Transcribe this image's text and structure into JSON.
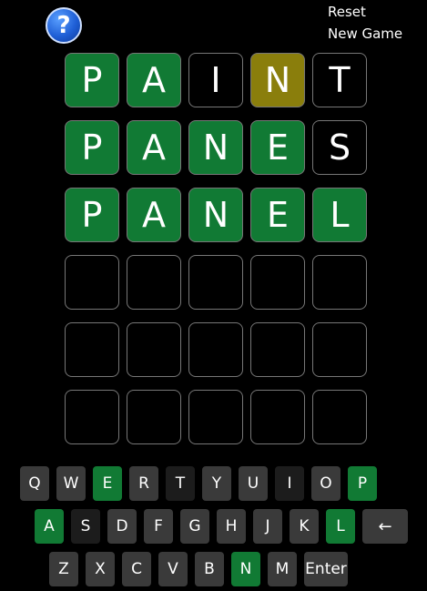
{
  "help": {
    "glyph": "?"
  },
  "menu": {
    "reset": "Reset",
    "new_game": "New Game"
  },
  "grid": {
    "rows": [
      [
        {
          "letter": "P",
          "state": "green"
        },
        {
          "letter": "A",
          "state": "green"
        },
        {
          "letter": "I",
          "state": "dark"
        },
        {
          "letter": "N",
          "state": "yellow"
        },
        {
          "letter": "T",
          "state": "dark"
        }
      ],
      [
        {
          "letter": "P",
          "state": "green"
        },
        {
          "letter": "A",
          "state": "green"
        },
        {
          "letter": "N",
          "state": "green"
        },
        {
          "letter": "E",
          "state": "green"
        },
        {
          "letter": "S",
          "state": "dark"
        }
      ],
      [
        {
          "letter": "P",
          "state": "green"
        },
        {
          "letter": "A",
          "state": "green"
        },
        {
          "letter": "N",
          "state": "green"
        },
        {
          "letter": "E",
          "state": "green"
        },
        {
          "letter": "L",
          "state": "green"
        }
      ],
      [
        {
          "letter": "",
          "state": "empty"
        },
        {
          "letter": "",
          "state": "empty"
        },
        {
          "letter": "",
          "state": "empty"
        },
        {
          "letter": "",
          "state": "empty"
        },
        {
          "letter": "",
          "state": "empty"
        }
      ],
      [
        {
          "letter": "",
          "state": "empty"
        },
        {
          "letter": "",
          "state": "empty"
        },
        {
          "letter": "",
          "state": "empty"
        },
        {
          "letter": "",
          "state": "empty"
        },
        {
          "letter": "",
          "state": "empty"
        }
      ],
      [
        {
          "letter": "",
          "state": "empty"
        },
        {
          "letter": "",
          "state": "empty"
        },
        {
          "letter": "",
          "state": "empty"
        },
        {
          "letter": "",
          "state": "empty"
        },
        {
          "letter": "",
          "state": "empty"
        }
      ]
    ]
  },
  "keyboard": {
    "rows": [
      [
        {
          "label": "Q",
          "state": "unused"
        },
        {
          "label": "W",
          "state": "unused"
        },
        {
          "label": "E",
          "state": "green"
        },
        {
          "label": "R",
          "state": "unused"
        },
        {
          "label": "T",
          "state": "dark"
        },
        {
          "label": "Y",
          "state": "unused"
        },
        {
          "label": "U",
          "state": "unused"
        },
        {
          "label": "I",
          "state": "dark"
        },
        {
          "label": "O",
          "state": "unused"
        },
        {
          "label": "P",
          "state": "green"
        }
      ],
      [
        {
          "label": "A",
          "state": "green"
        },
        {
          "label": "S",
          "state": "dark"
        },
        {
          "label": "D",
          "state": "unused"
        },
        {
          "label": "F",
          "state": "unused"
        },
        {
          "label": "G",
          "state": "unused"
        },
        {
          "label": "H",
          "state": "unused"
        },
        {
          "label": "J",
          "state": "unused"
        },
        {
          "label": "K",
          "state": "unused"
        },
        {
          "label": "L",
          "state": "green"
        },
        {
          "label": "←",
          "state": "unused",
          "kind": "back"
        }
      ],
      [
        {
          "label": "Z",
          "state": "unused"
        },
        {
          "label": "X",
          "state": "unused"
        },
        {
          "label": "C",
          "state": "unused"
        },
        {
          "label": "V",
          "state": "unused"
        },
        {
          "label": "B",
          "state": "unused"
        },
        {
          "label": "N",
          "state": "green"
        },
        {
          "label": "M",
          "state": "unused"
        },
        {
          "label": "Enter",
          "state": "unused",
          "kind": "enter"
        }
      ]
    ]
  },
  "colors": {
    "green": "#117a34",
    "yellow": "#8a7e0c",
    "key_unused": "#3a3a3a",
    "key_absent": "#1c1c1c",
    "background": "#000000"
  }
}
